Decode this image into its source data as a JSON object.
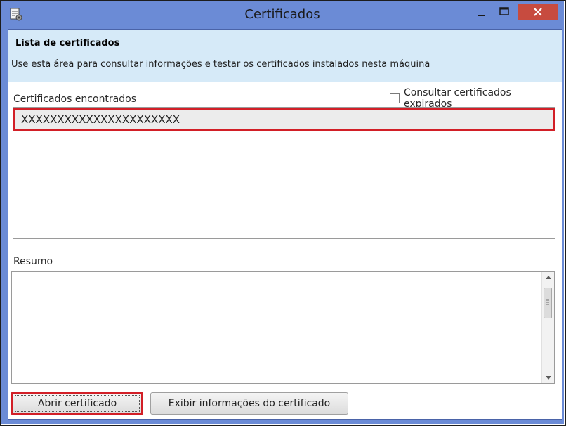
{
  "window": {
    "title": "Certificados",
    "icon": "certificate-app-icon",
    "controls": [
      "minimize-icon",
      "maximize-icon",
      "close-icon"
    ]
  },
  "header": {
    "title": "Lista de certificados",
    "description": "Use esta área para consultar informações e testar os certificados instalados nesta máquina"
  },
  "certificates": {
    "label": "Certificados encontrados",
    "expired_checkbox_label": "Consultar certificados expirados",
    "expired_checked": false,
    "items": [
      "XXXXXXXXXXXXXXXXXXXXXX"
    ]
  },
  "summary": {
    "label": "Resumo",
    "content": ""
  },
  "buttons": {
    "open_label": "Abrir certificado",
    "info_label": "Exibir informações do certificado"
  },
  "colors": {
    "titlebar": "#6b8bd6",
    "header_band": "#d6eaf8",
    "highlight": "#d21f27",
    "close_button": "#c74b3f"
  }
}
